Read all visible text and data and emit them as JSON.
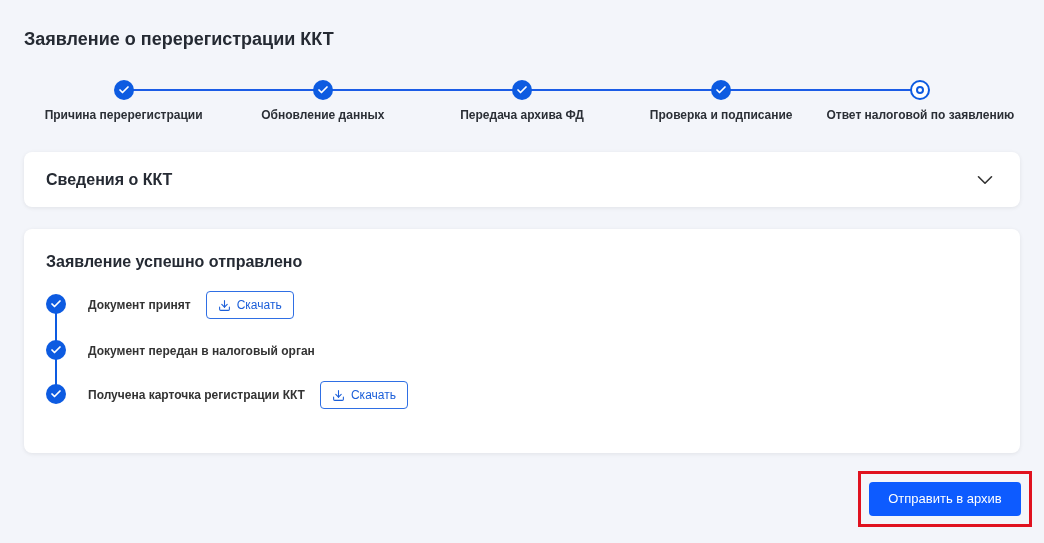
{
  "title": "Заявление о перерегистрации ККТ",
  "steps": [
    {
      "label": "Причина перерегистрации",
      "completed": true
    },
    {
      "label": "Обновление данных",
      "completed": true
    },
    {
      "label": "Передача архива ФД",
      "completed": true
    },
    {
      "label": "Проверка и подписание",
      "completed": true
    },
    {
      "label": "Ответ налоговой по заявлению",
      "completed": false
    }
  ],
  "kkt_section": {
    "title": "Сведения о ККТ",
    "expanded": false
  },
  "status_card": {
    "title": "Заявление успешно отправлено",
    "events": [
      {
        "text": "Документ принят",
        "done": true,
        "button": "Скачать"
      },
      {
        "text": "Документ передан в налоговый орган",
        "done": true
      },
      {
        "text": "Получена карточка регистрации ККТ",
        "done": true,
        "button": "Скачать"
      }
    ]
  },
  "archive_button": {
    "label": "Отправить в архив",
    "highlighted": true
  }
}
